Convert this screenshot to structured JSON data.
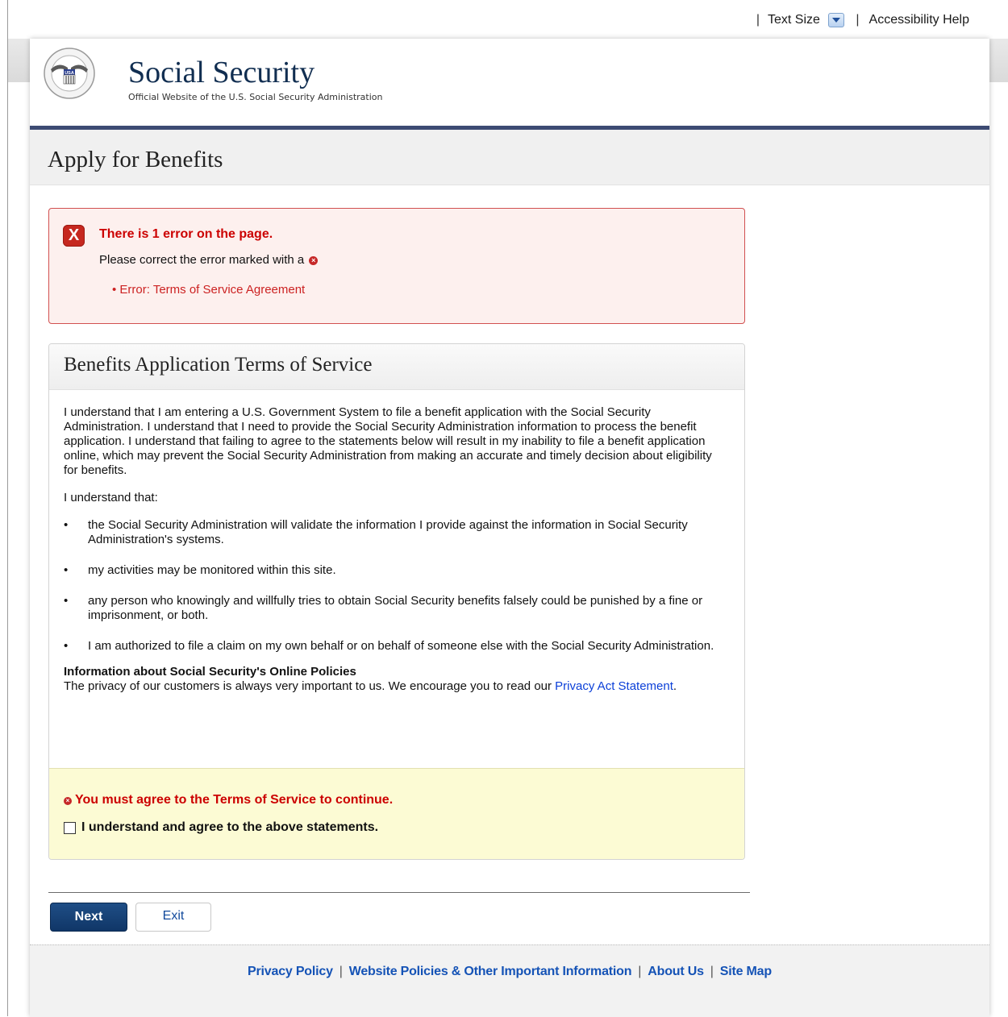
{
  "utility": {
    "separator": "|",
    "text_size_label": "Text Size",
    "accessibility_label": "Accessibility Help"
  },
  "header": {
    "brand_title": "Social Security",
    "brand_subtitle": "Official Website of the U.S. Social Security Administration",
    "seal_text": "SOCIAL SECURITY ADMINISTRATION",
    "seal_badge": "USA"
  },
  "page": {
    "title": "Apply for Benefits"
  },
  "error_summary": {
    "icon": "X",
    "heading": "There is 1 error on the page.",
    "instruction": "Please correct the error marked with a",
    "error_link": "• Error: Terms of Service Agreement"
  },
  "terms": {
    "title": "Benefits Application Terms of Service",
    "intro": "I understand that I am entering a U.S. Government System to file a benefit application with the Social Security Administration.  I understand that I need to provide the Social Security Administration information to process the benefit application.  I understand that failing to agree to the statements below will result in my inability to file a benefit application online, which may prevent the Social Security Administration from making an accurate and timely decision about eligibility for benefits.",
    "understand_that": "I understand that:",
    "bullets": [
      "the Social Security Administration will validate the information I provide against the information in Social Security Administration's systems.",
      "my activities may be monitored within this site.",
      "any person who knowingly and willfully tries to obtain Social Security benefits falsely could be punished by a fine or imprisonment, or both.",
      "I am authorized to file a claim on my own behalf or on behalf of someone else with the Social Security Administration."
    ],
    "policies_heading": "Information about Social Security's Online Policies",
    "policies_text": "The privacy of our customers is always very important to us.  We encourage you to read our",
    "privacy_act_link": "Privacy Act Statement",
    "policies_end": ".",
    "agree_error": "You must agree to the Terms of Service to continue.",
    "agree_label": "I understand and agree to the above statements.",
    "agree_checked": false
  },
  "buttons": {
    "next": "Next",
    "exit": "Exit"
  },
  "footer": {
    "privacy_policy": "Privacy Policy",
    "website_policies": "Website Policies & Other Important Information",
    "about_us": "About Us",
    "site_map": "Site Map",
    "separator": "|"
  },
  "colors": {
    "brand_navy": "#112e51",
    "header_rule": "#3d4b73",
    "error_red": "#cc0000",
    "link_blue": "#0b3fd8",
    "agree_background": "#fcfbd4"
  }
}
